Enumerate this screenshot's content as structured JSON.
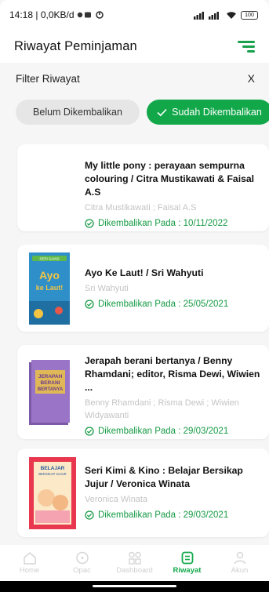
{
  "status_bar": {
    "time_text": "14:18 | 0,0KB/d",
    "battery": "100"
  },
  "app_bar": {
    "title": "Riwayat Peminjaman",
    "filter_icon": "filter-list-icon"
  },
  "filter": {
    "title": "Filter Riwayat",
    "close_label": "X",
    "chips": [
      {
        "label": "Belum Dikembalikan",
        "selected": false
      },
      {
        "label": "Sudah Dikembalikan",
        "selected": true
      }
    ]
  },
  "history": [
    {
      "title": "My little pony :  perayaan sempurna colouring / Citra Mustikawati & Faisal A.S",
      "authors": "Citra Mustikawati ; Faisal A.S",
      "returned_text": "Dikembalikan Pada : 10/11/2022",
      "cover": null
    },
    {
      "title": "Ayo Ke Laut! / Sri Wahyuti",
      "authors": "Sri Wahyuti",
      "returned_text": "Dikembalikan Pada : 25/05/2021",
      "cover": {
        "line1": "Ayo",
        "line2": "ke Laut!",
        "top_text": "SERI SAINS"
      }
    },
    {
      "title": "Jerapah berani bertanya / Benny Rhamdani; editor, Risma Dewi, Wiwien ...",
      "authors": "Benny Rhamdani ; Risma Dewi ; Wiwien Widyawanti",
      "returned_text": "Dikembalikan Pada : 29/03/2021",
      "cover": {
        "line1": "JERAPAH",
        "line2": "BERANI",
        "line3": "BERTANYA"
      }
    },
    {
      "title": "Seri Kimi & Kino :  Belajar Bersikap Jujur / Veronica Winata",
      "authors": "Veronica Winata",
      "returned_text": "Dikembalikan Pada : 29/03/2021",
      "cover": {
        "line1": "BELAJAR",
        "line2": "BERSIKAP JUJUR"
      }
    }
  ],
  "colors": {
    "accent": "#12a84a",
    "muted": "#c4c4c4"
  },
  "bottom_nav": [
    {
      "label": "Home",
      "icon": "home-icon",
      "active": false
    },
    {
      "label": "Opac",
      "icon": "compass-icon",
      "active": false
    },
    {
      "label": "Dashboard",
      "icon": "dashboard-icon",
      "active": false
    },
    {
      "label": "Riwayat",
      "icon": "history-icon",
      "active": true
    },
    {
      "label": "Akun",
      "icon": "person-icon",
      "active": false
    }
  ]
}
